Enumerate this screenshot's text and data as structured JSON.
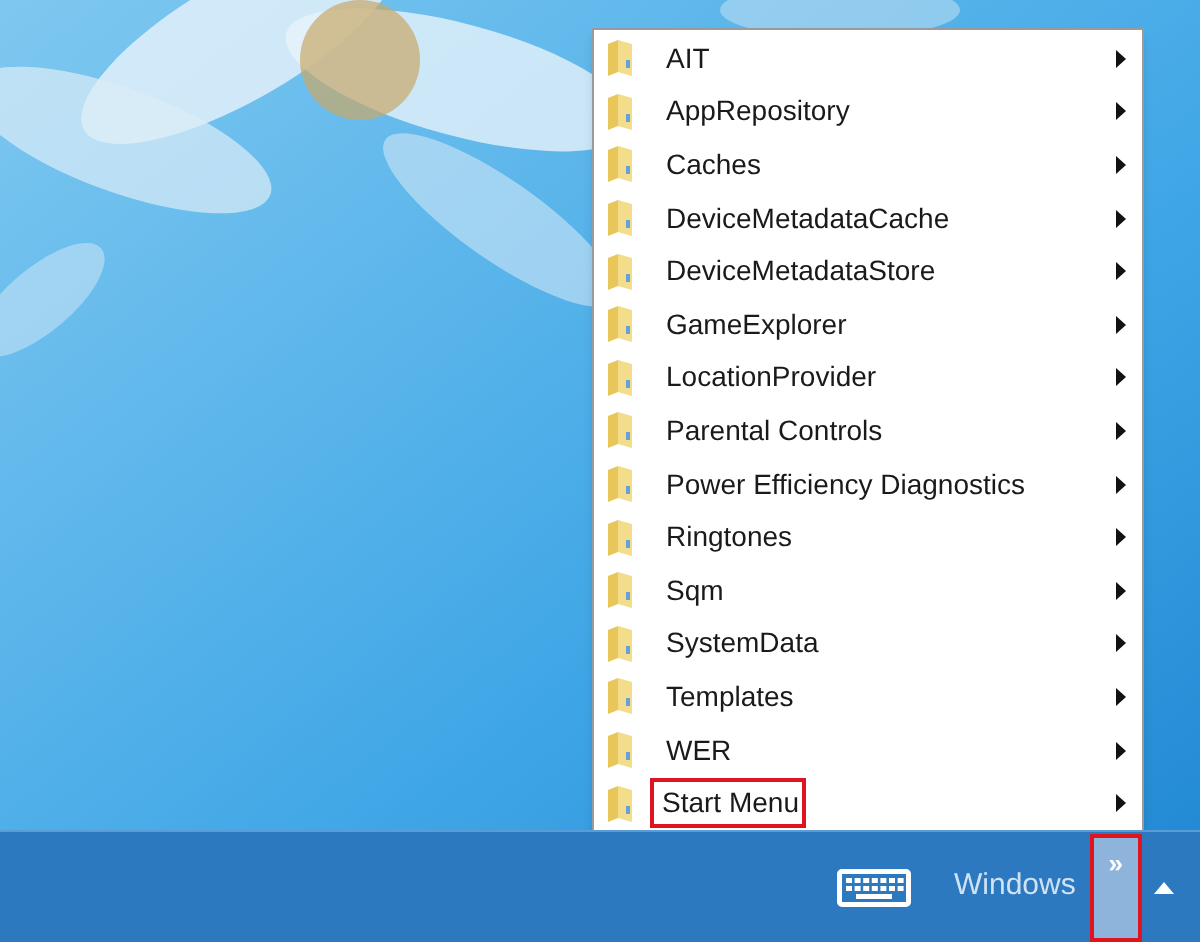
{
  "menu": {
    "items": [
      {
        "label": "AIT",
        "highlighted": false
      },
      {
        "label": "AppRepository",
        "highlighted": false
      },
      {
        "label": "Caches",
        "highlighted": false
      },
      {
        "label": "DeviceMetadataCache",
        "highlighted": false
      },
      {
        "label": "DeviceMetadataStore",
        "highlighted": false
      },
      {
        "label": "GameExplorer",
        "highlighted": false
      },
      {
        "label": "LocationProvider",
        "highlighted": false
      },
      {
        "label": "Parental Controls",
        "highlighted": false
      },
      {
        "label": "Power Efficiency Diagnostics",
        "highlighted": false
      },
      {
        "label": "Ringtones",
        "highlighted": false
      },
      {
        "label": "Sqm",
        "highlighted": false
      },
      {
        "label": "SystemData",
        "highlighted": false
      },
      {
        "label": "Templates",
        "highlighted": false
      },
      {
        "label": "WER",
        "highlighted": false
      },
      {
        "label": "Start Menu",
        "highlighted": true
      }
    ]
  },
  "taskbar": {
    "toolbar_label": "Windows",
    "expand_button": {
      "label": "»",
      "highlighted": true
    }
  }
}
